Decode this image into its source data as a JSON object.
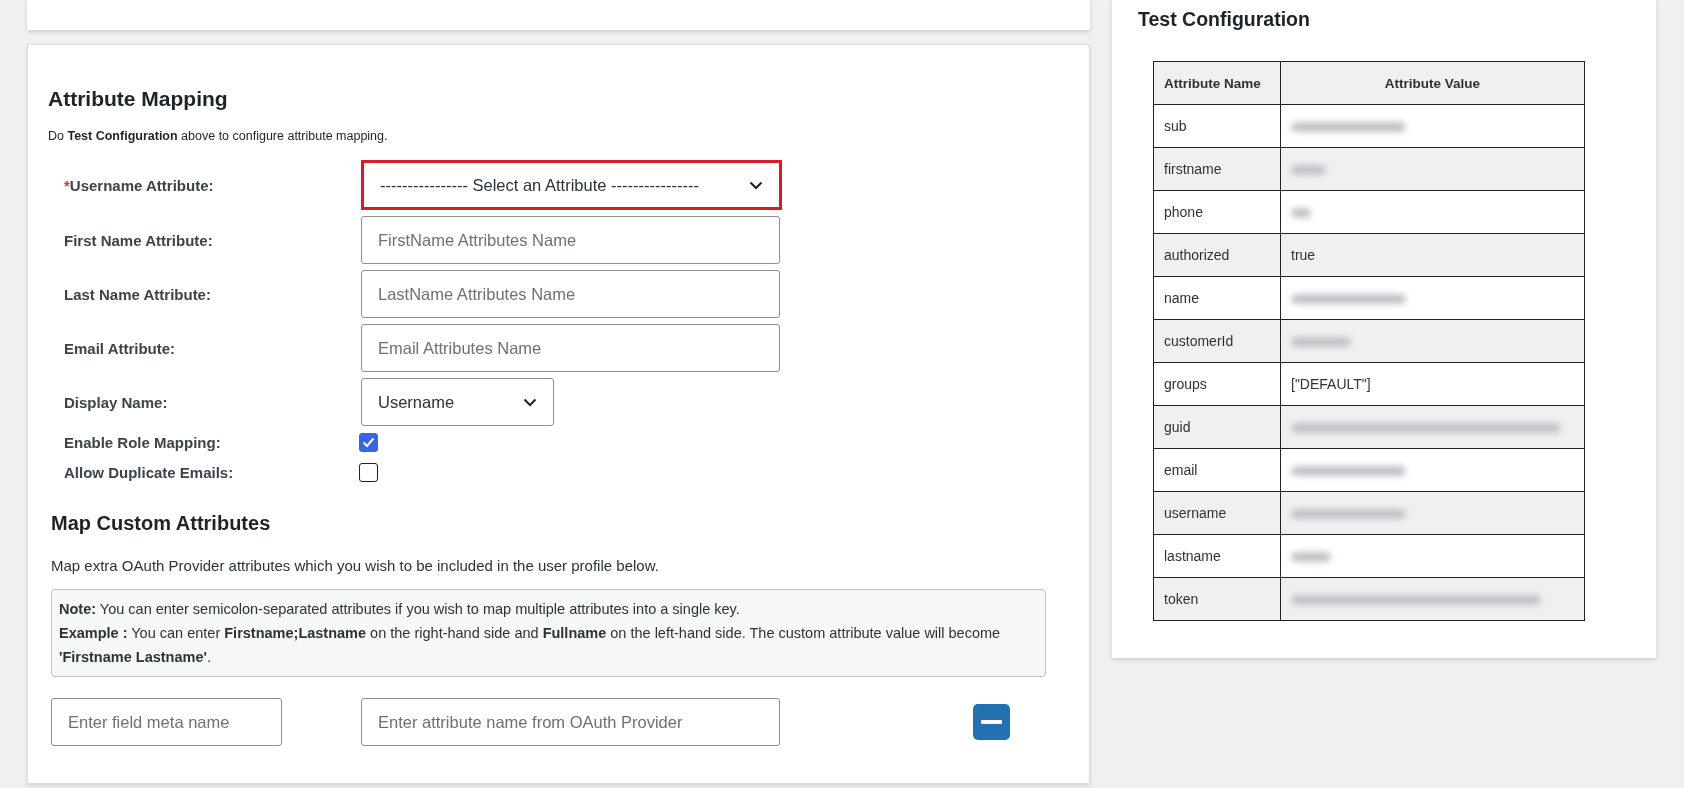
{
  "attribute_mapping": {
    "title": "Attribute Mapping",
    "intro": "Do **Test Configuration** above to configure attribute mapping.",
    "fields": [
      {
        "kind": "select",
        "required_mark": "*",
        "label": "Username Attribute:",
        "value": "---------------- Select an Attribute ----------------",
        "highlighted": true
      },
      {
        "kind": "text",
        "label": "First Name Attribute:",
        "placeholder": "FirstName Attributes Name",
        "highlighted": false
      },
      {
        "kind": "text",
        "label": "Last Name Attribute:",
        "placeholder": "LastName Attributes Name",
        "highlighted": false
      },
      {
        "kind": "text",
        "label": "Email Attribute:",
        "placeholder": "Email Attributes Name",
        "highlighted": false
      },
      {
        "kind": "select",
        "label": "Display Name:",
        "value": "Username",
        "highlighted": false
      },
      {
        "kind": "checkbox",
        "label": "Enable Role Mapping:",
        "checked": true
      },
      {
        "kind": "checkbox",
        "label": "Allow Duplicate Emails:",
        "checked": false
      }
    ]
  },
  "custom_attributes": {
    "title": "Map Custom Attributes",
    "description": "Map extra OAuth Provider attributes which you wish to be included in the user profile below.",
    "note": [
      "**Note:** You can enter semicolon-separated attributes if you wish to map multiple attributes into a single key.",
      "**Example :** You can enter **Firstname;Lastname** on the right-hand side and **Fullname** on the left-hand side. The custom attribute value will become **'Firstname Lastname'**."
    ],
    "mapping_row": {
      "meta_placeholder": "Enter field meta name",
      "attribute_placeholder": "Enter attribute name from OAuth Provider"
    }
  },
  "test_configuration": {
    "title": "Test Configuration",
    "columns": [
      "Attribute Name",
      "Attribute Value"
    ],
    "rows": [
      {
        "name": "sub",
        "redacted": true
      },
      {
        "name": "firstname",
        "redacted": true
      },
      {
        "name": "phone",
        "redacted": true
      },
      {
        "name": "authorized",
        "value": "true",
        "redacted": false
      },
      {
        "name": "name",
        "redacted": true
      },
      {
        "name": "customerId",
        "redacted": true
      },
      {
        "name": "groups",
        "value": "[\"DEFAULT\"]",
        "redacted": false
      },
      {
        "name": "guid",
        "redacted": true
      },
      {
        "name": "email",
        "redacted": true
      },
      {
        "name": "username",
        "redacted": true
      },
      {
        "name": "lastname",
        "redacted": true
      },
      {
        "name": "token",
        "redacted": true
      }
    ]
  }
}
